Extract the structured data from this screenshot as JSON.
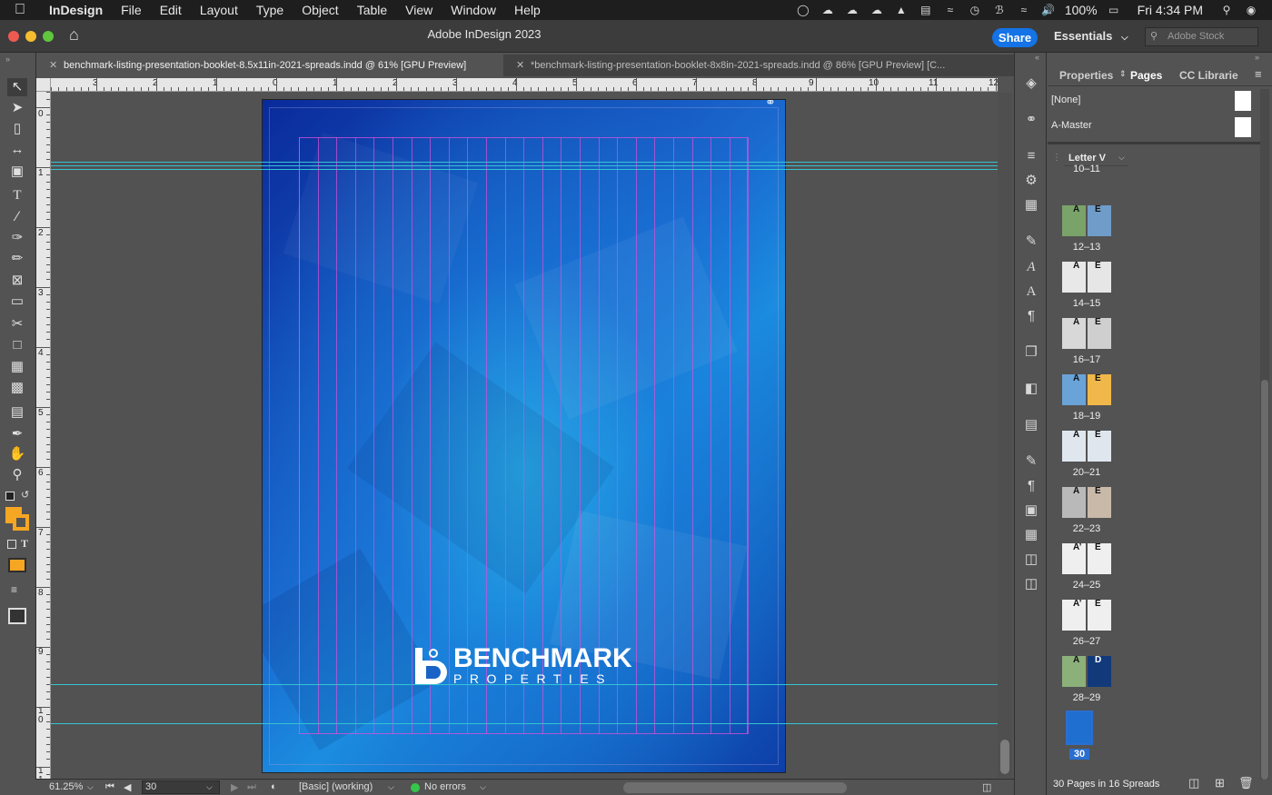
{
  "menubar": {
    "app": "InDesign",
    "items": [
      "File",
      "Edit",
      "Layout",
      "Type",
      "Object",
      "Table",
      "View",
      "Window",
      "Help"
    ],
    "battery": "100%",
    "clock": "Fri 4:34 PM"
  },
  "titlebar": {
    "title": "Adobe InDesign 2023",
    "share": "Share",
    "workspace": "Essentials",
    "search_placeholder": "Adobe Stock"
  },
  "tabs": [
    {
      "label": "benchmark-listing-presentation-booklet-8.5x11in-2021-spreads.indd @ 61% [GPU Preview]",
      "active": true
    },
    {
      "label": "*benchmark-listing-presentation-booklet-8x8in-2021-spreads.indd @ 86% [GPU Preview] [C...",
      "active": false
    }
  ],
  "rulers": {
    "horizontal": [
      "3",
      "2",
      "1",
      "0",
      "1",
      "2",
      "3",
      "4",
      "5",
      "6",
      "7",
      "8",
      "9",
      "10",
      "11",
      "12"
    ],
    "vertical": [
      "0",
      "1",
      "2",
      "3",
      "4",
      "5",
      "6",
      "7",
      "8",
      "9",
      "1 0",
      "1 1"
    ]
  },
  "document": {
    "logo_word": "BENCHMARK",
    "logo_sub": "PROPERTIES"
  },
  "statusbar": {
    "zoom": "61.25%",
    "page": "30",
    "preflight_profile": "[Basic] (working)",
    "errors": "No errors"
  },
  "panel": {
    "tabs": [
      "Properties",
      "Pages",
      "CC Librarie"
    ],
    "masters": [
      "[None]",
      "A-Master"
    ],
    "size_dropdown": "Letter V",
    "spreads": [
      "10–11",
      "12–13",
      "14–15",
      "16–17",
      "18–19",
      "20–21",
      "22–23",
      "24–25",
      "26–27",
      "28–29",
      "30"
    ],
    "footer": "30 Pages in 16 Spreads"
  },
  "colors": {
    "accent": "#1473e6",
    "guide": "#35c3d2",
    "column_guide": "#dc50dc",
    "fill_swatch": "#f5a623"
  }
}
